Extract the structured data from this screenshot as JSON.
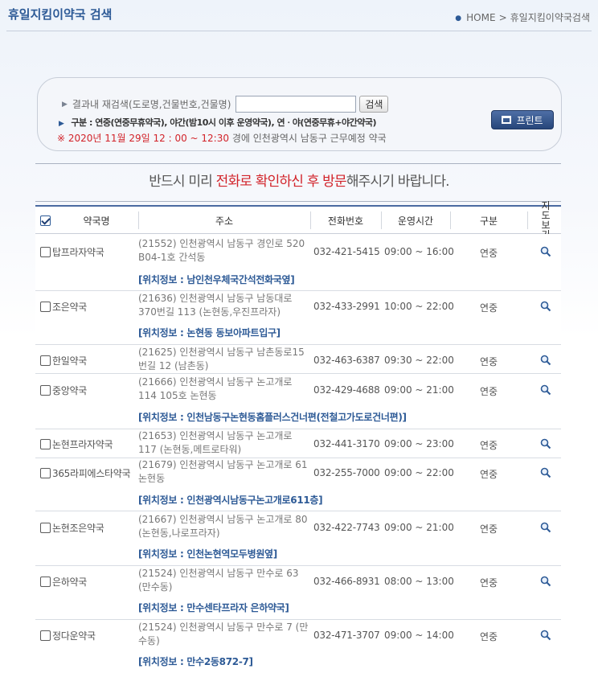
{
  "header": {
    "title": "휴일지킴이약국 검색",
    "breadcrumb": [
      "HOME",
      "휴일지킴이약국검색"
    ],
    "separator": ">"
  },
  "search": {
    "label": "결과내 재검색(도로명,건물번호,건물명)",
    "value": "",
    "button": "검색",
    "legend": "구분 : 연중(연중무휴약국), 야간(밤10시 이후 운영약국), 연ㆍ야(연중무휴+야간약국)",
    "date_line": "※ 2020년 11월 29일 12 : 00 ~ 12:30",
    "date_rest": "경에   인천광역시   남동구    근무예정  약국",
    "print_label": "프린트"
  },
  "notice": {
    "pre": "반드시 미리 ",
    "red1": "전화로 확인하신 후 방문",
    "post": "해주시기 바랍니다."
  },
  "table": {
    "headers": {
      "name": "약국명",
      "address": "주소",
      "phone": "전화번호",
      "hours": "운영시간",
      "type": "구분",
      "map": "지도보기"
    },
    "rows": [
      {
        "name": "탑프라자약국",
        "address": "(21552) 인천광역시 남동구 경인로 520 B04-1호 간석동",
        "phone": "032-421-5415",
        "hours": "09:00 ~ 16:00",
        "type": "연중",
        "location": "[위치정보 : 남인천우체국간석전화국옆]"
      },
      {
        "name": "조은약국",
        "address": "(21636) 인천광역시 남동구 남동대로 370번길 113 (논현동,우진프라자)",
        "phone": "032-433-2991",
        "hours": "10:00 ~ 22:00",
        "type": "연중",
        "location": "[위치정보 : 논현동 동보아파트입구]"
      },
      {
        "name": "한일약국",
        "address": "(21625) 인천광역시 남동구 남촌동로15번길 12 (남촌동)",
        "phone": "032-463-6387",
        "hours": "09:30 ~ 22:00",
        "type": "연중",
        "location": ""
      },
      {
        "name": "중앙약국",
        "address": "(21666) 인천광역시 남동구 논고개로 114 105호 논현동",
        "phone": "032-429-4688",
        "hours": "09:00 ~ 21:00",
        "type": "연중",
        "location": "[위치정보 : 인천남동구논현동홈플러스건너편(전철고가도로건너편)]"
      },
      {
        "name": "논현프라자약국",
        "address": "(21653) 인천광역시 남동구 논고개로 117 (논현동,메트로타워)",
        "phone": "032-441-3170",
        "hours": "09:00 ~ 23:00",
        "type": "연중",
        "location": ""
      },
      {
        "name": "365라피에스타약국",
        "address": "(21679) 인천광역시 남동구 논고개로 61 논현동",
        "phone": "032-255-7000",
        "hours": "09:00 ~ 22:00",
        "type": "연중",
        "location": "[위치정보 : 인천광역시남동구논고개로611층]"
      },
      {
        "name": "논현조은약국",
        "address": "(21667) 인천광역시 남동구 논고개로 80 (논현동,나로프라자)",
        "phone": "032-422-7743",
        "hours": "09:00 ~ 21:00",
        "type": "연중",
        "location": "[위치정보 : 인천논현역모두병원옆]"
      },
      {
        "name": "은하약국",
        "address": "(21524) 인천광역시 남동구 만수로 63 (만수동)",
        "phone": "032-466-8931",
        "hours": "08:00 ~ 13:00",
        "type": "연중",
        "location": "[위치정보 : 만수센타프라자 은하약국]"
      },
      {
        "name": "정다운약국",
        "address": "(21524) 인천광역시 남동구 만수로 7 (만수동)",
        "phone": "032-471-3707",
        "hours": "09:00 ~ 14:00",
        "type": "연중",
        "location": "[위치정보 : 만수2동872-7]"
      }
    ]
  },
  "icons": {
    "map": "magnifier-icon",
    "print": "printer-icon",
    "arrow": "triangle-right-icon"
  },
  "colors": {
    "brand": "#2d5a96",
    "alert": "#d2232a",
    "header_rule": "#4a6aa1"
  }
}
